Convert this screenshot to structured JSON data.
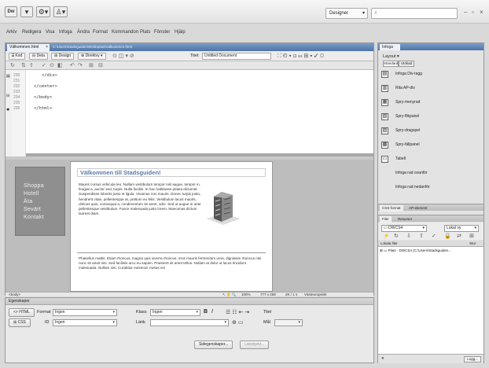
{
  "titlebar": {
    "dw_icon": "Dw",
    "layout_menu": "▾",
    "extend_menu": "⚙▾",
    "site_menu": "♙▾",
    "workspace": "Designer",
    "workspace_arrow": "▾",
    "search_placeholder": "",
    "minimize": "–",
    "restore": "▫",
    "close": "×"
  },
  "menubar": [
    "Arkiv",
    "Redigera",
    "Visa",
    "Infoga",
    "Ändra",
    "Format",
    "Kommandon",
    "Plats",
    "Fönster",
    "Hjälp"
  ],
  "document": {
    "tab_label": "Välkommen.html",
    "path": "C:\\Users\\Stadsguiden\\Webbplats\\Välkommen.html",
    "view_buttons": [
      "Kod",
      "Dela",
      "Design",
      "Direktvy"
    ],
    "title_label": "Titel:",
    "title_value": "Untitled Document",
    "code_lines": [
      {
        "num": "230",
        "text": "</div>"
      },
      {
        "num": "231",
        "text": ""
      },
      {
        "num": "232",
        "text": "</center>"
      },
      {
        "num": "233",
        "text": ""
      },
      {
        "num": "234",
        "text": "</body>"
      },
      {
        "num": "235",
        "text": ""
      },
      {
        "num": "236",
        "text": "</html>"
      }
    ]
  },
  "design": {
    "nav_items": [
      "Shoppa",
      "Hotell",
      "Äta",
      "Sevärt",
      "Kontakt"
    ],
    "page_title": "Välkommen till Stadsguiden!",
    "para1": "Mauris cursus vehicula leo. Nullam vestibulum tempor nisl augue, tempor in, feugiat a, auctor sed, turpis. Nulla facilisi. In hac habitasse platea dictumst. Suspendisse lobortis justo et ligula. Vivamus non mauris. Donec turpis justo, hendrerit vitae, pellentesque at, pretium eu felis. Vestibulum lacus mauris, ultrices quis, consequat a, condimentum sit amet, odio. Sed ut augue in ante pellentesque vestibulum. Fusce malesuada justo lorem. Maecenas dictum laoreet diam.",
    "para2": "Phasellus mattis. Etiam rhoncus, magna quis viverra rhoncus, eros mauris fermentum urna, dignissim rhoncus nisi nunc sit amet nisi. Sed facilisis arcu eu sapien. Praesent sit amet tellus. Nullam at dolor ut lacus tincidunt malesuada. Nullam nisi. Curabitur euismod, metus vel"
  },
  "statusbar": {
    "tag": "<body>",
    "zoom": "100%",
    "dimensions": "777 x 269",
    "size": "2K / 1 s",
    "encoding": "Västeuropeisk"
  },
  "properties": {
    "title": "Egenskaper",
    "html_button": "HTML",
    "css_button": "CSS",
    "format_label": "Format",
    "format_value": "Ingen",
    "class_label": "Klass",
    "class_value": "Ingen",
    "id_label": "ID",
    "id_value": "Ingen",
    "link_label": "Länk",
    "title_label": "Titel",
    "target_label": "Mål",
    "bold": "B",
    "italic": "I",
    "page_props_button": "Sidegenskaper...",
    "list_item_button": "Listobjekt..."
  },
  "insert_panel": {
    "tab": "Infoga",
    "category": "Layout",
    "mode_standard": "Standard",
    "mode_utokad": "Utökad",
    "items": [
      {
        "icon": "▤",
        "label": "Infoga Div-tagg"
      },
      {
        "icon": "▥",
        "label": "Rita AP-div"
      },
      {
        "icon": "▦",
        "label": "Spry-menyrad"
      },
      {
        "icon": "▧",
        "label": "Spry-flikpanel"
      },
      {
        "icon": "▨",
        "label": "Spry-dragspel"
      },
      {
        "icon": "▩",
        "label": "Spry-fällpanel"
      },
      {
        "icon": "▭",
        "label": "Tabell"
      },
      {
        "icon": "",
        "label": "Infoga rad ovanför"
      },
      {
        "icon": "",
        "label": "Infoga rad nedanför"
      }
    ]
  },
  "css_panel": {
    "tabs": [
      "CSS-format",
      "AP-element"
    ]
  },
  "files_panel": {
    "tabs": [
      "Filer",
      "Resurser"
    ],
    "site": "DWCS4",
    "view": "Lokal vy",
    "columns": [
      "Lokala filer",
      "Stor"
    ],
    "root": "Plats - DWCS4 (C:\\Users\\Stadsguiden...",
    "log_button": "Logg..."
  }
}
